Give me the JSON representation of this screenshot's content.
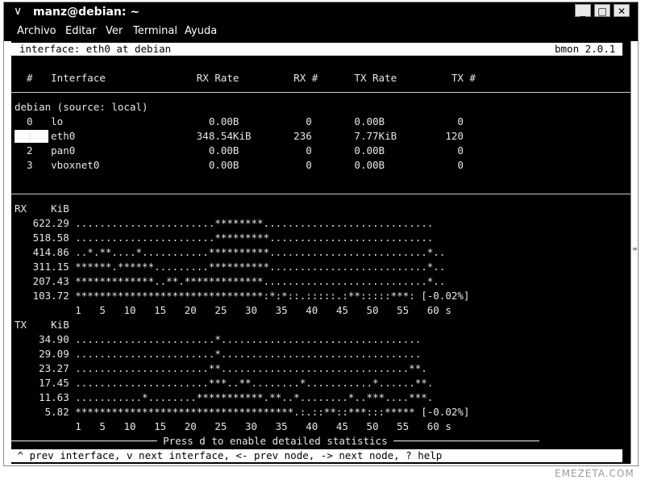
{
  "window": {
    "title": "manz@debian: ~",
    "menu_glyph": "∨",
    "buttons": {
      "minimize": "_",
      "maximize": "□",
      "close": "✕"
    }
  },
  "menubar": {
    "items": [
      "Archivo",
      "Editar",
      "Ver",
      "Terminal",
      "Ayuda"
    ]
  },
  "header": {
    "interface_line": "interface: eth0 at debian",
    "version": "bmon 2.0.1"
  },
  "table": {
    "columns_line": "  #   Interface               RX Rate         RX #      TX Rate         TX #",
    "source_line": "debian (source: local)",
    "rows": [
      "  0   lo                        0.00B           0       0.00B            0",
      "  1   eth0                    348.54KiB       236       7.77KiB        120",
      "  2   pan0                      0.00B           0       0.00B            0",
      "  3   vboxnet0                  0.00B           0       0.00B            0"
    ],
    "selected_index": 1
  },
  "rx_graph": {
    "header": "RX    KiB",
    "rows": [
      "   622.29 .......................********............................",
      "   518.58 .......................*********...........................",
      "   414.86 ..*.**....*...........**********..........................*..",
      "   311.15 ******.******.........**********..........................*..",
      "   207.43 *************..**.*************...........................*..",
      "   103.72 *******************************:*:*::.:::::.:**:::::***: [-0.02%]"
    ],
    "axis": "          1   5   10   15   20   25   30   35   40   45   50   55   60 s"
  },
  "tx_graph": {
    "header": "TX    KiB",
    "rows": [
      "    34.90 .......................*.................................",
      "    29.09 .......................*.................................",
      "    23.27 ......................**...............................**.",
      "    17.45 ......................***..**........*...........*......**.",
      "    11.63 ...........*........***********.**..*........*..***....***.",
      "     5.82 ************************************.:.::**::***:::***** [-0.02%]"
    ],
    "axis": "          1   5   10   15   20   25   30   35   40   45   50   55   60 s"
  },
  "footer": {
    "hint_line": "──────────────────────── Press d to enable detailed statistics ────────────────────────",
    "help_line": " ^ prev interface, v next interface, <- prev node, -> next node, ? help"
  },
  "watermark": "EMEZETA.COM"
}
